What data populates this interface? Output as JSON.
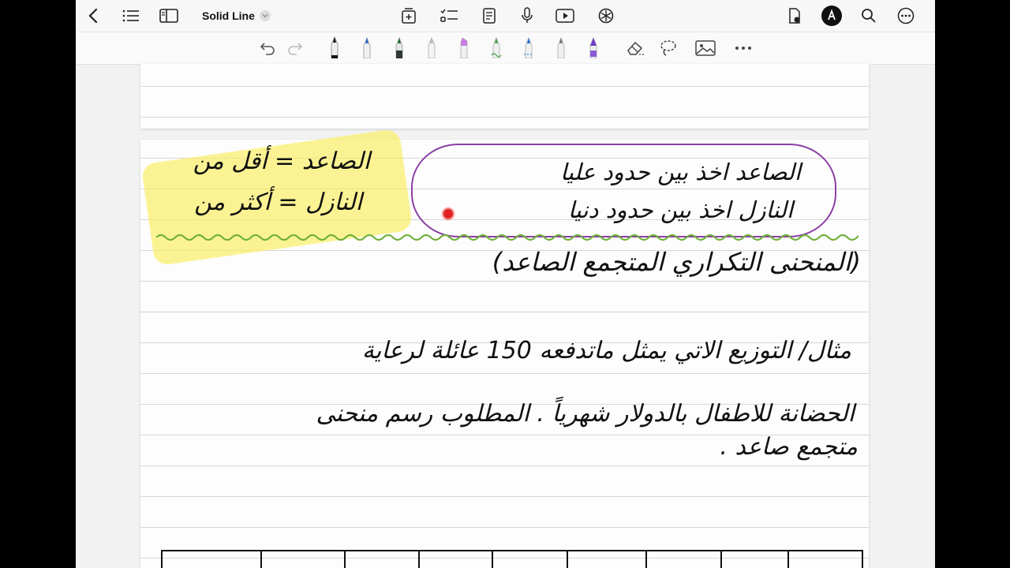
{
  "topbar": {
    "title": "Solid Line",
    "left_icons": [
      "back-chevron-icon",
      "list-icon",
      "sidebar-icon"
    ],
    "center_icons": [
      "add-page-icon",
      "checklist-icon",
      "document-icon",
      "microphone-icon",
      "play-icon",
      "ai-assistant-icon"
    ],
    "right_icons": [
      "document-lock-icon",
      "pen-mode-icon",
      "search-icon",
      "more-icon"
    ]
  },
  "toolbar": {
    "tools": [
      "undo-icon",
      "redo-icon",
      "fountain-pen-icon",
      "ballpoint-pen-icon",
      "marker-green-icon",
      "pencil-icon",
      "highlighter-purple-icon",
      "highlighter-green-icon",
      "pen-blue-icon",
      "pencil-gray-icon",
      "highlighter-violet-icon",
      "eraser-icon",
      "lasso-icon",
      "image-icon",
      "more-icon"
    ]
  },
  "note": {
    "left_line1": "الصاعد = أقل من",
    "left_line2": "النازل = أكثر من",
    "bubble_line1": "الصاعد اخذ بين حدود عليا",
    "bubble_line2": "النازل اخذ بين حدود دنيا",
    "heading": "(المنحنى التكراري المتجمع الصاعد)",
    "example_line1": "مثال/ التوزيع الاتي يمثل ماتدفعه 150 عائلة لرعاية",
    "example_line2": "الحضانة للاطفال بالدولار شهرياً . المطلوب رسم منحنى",
    "example_line3": "متجمع صاعد ."
  }
}
